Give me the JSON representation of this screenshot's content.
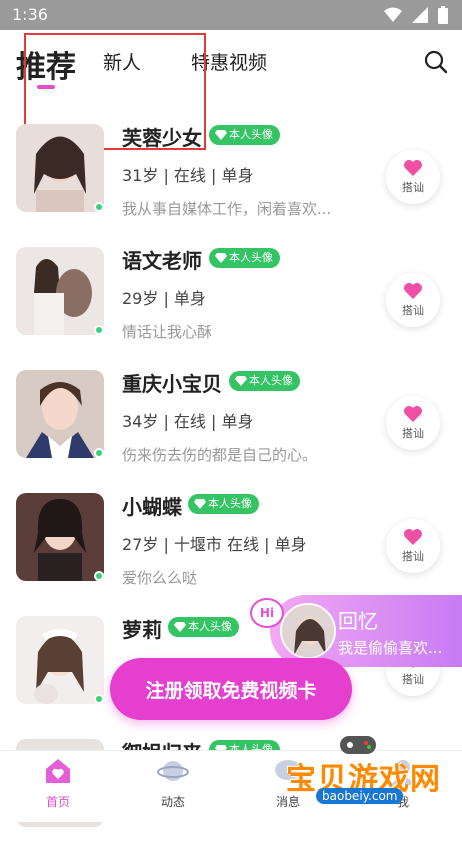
{
  "status": {
    "time": "1:36"
  },
  "tabs": [
    {
      "label": "推荐",
      "active": true
    },
    {
      "label": "新人",
      "active": false
    },
    {
      "label": "特惠视频",
      "active": false
    }
  ],
  "list": [
    {
      "name": "芙蓉少女",
      "badge": "本人头像",
      "meta": "31岁 | 在线 | 单身",
      "bio": "我从事自媒体工作，闲着喜欢...",
      "action": "搭讪",
      "online": true
    },
    {
      "name": "语文老师",
      "badge": "本人头像",
      "meta": "29岁 | 单身",
      "bio": "情话让我心酥",
      "action": "搭讪",
      "online": true
    },
    {
      "name": "重庆小宝贝",
      "badge": "本人头像",
      "meta": "34岁 | 在线 | 单身",
      "bio": "伤来伤去伤的都是自己的心。",
      "action": "搭讪",
      "online": true
    },
    {
      "name": "小蝴蝶",
      "badge": "本人头像",
      "meta": "27岁 | 十堰市 在线 | 单身",
      "bio": "爱你么么哒",
      "action": "搭讪",
      "online": true
    },
    {
      "name": "萝莉",
      "badge": "本人头像",
      "meta": "",
      "bio": "",
      "action": "搭讪",
      "online": true
    },
    {
      "name": "御姐归来",
      "badge": "本人头像",
      "meta": "",
      "bio": "",
      "action": "",
      "online": false
    }
  ],
  "cta": {
    "label": "注册领取免费视频卡"
  },
  "float_card": {
    "hi": "Hi",
    "name": "回忆",
    "message": "我是偷偷喜欢..."
  },
  "bottom_nav": [
    {
      "label": "首页",
      "active": true
    },
    {
      "label": "动态",
      "active": false
    },
    {
      "label": "消息",
      "active": false
    },
    {
      "label": "我",
      "active": false
    }
  ],
  "watermark": {
    "text": "宝贝游戏网",
    "url": "baobeiy.com"
  },
  "colors": {
    "accent": "#e04fd1",
    "badge": "#35c463",
    "online": "#35d27a",
    "cta": "#e53fcf"
  }
}
